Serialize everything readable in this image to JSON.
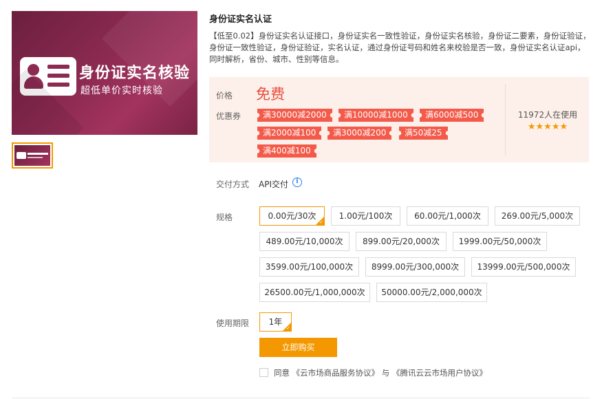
{
  "banner": {
    "title": "身份证实名核验",
    "subtitle": "超低单价实时核验"
  },
  "product": {
    "title": "身份证实名认证",
    "description": "【低至0.02】身份证实名认证接口，身份证实名一致性验证，身份证实名核验，身份证二要素，身份证验证，身份证一致性验证，身份证验证，实名认证，通过身份证号码和姓名来校验是否一致，身份证实名认证api，同时解析，省份、城市、性别等信息。"
  },
  "price": {
    "label": "价格",
    "value": "免费",
    "coupon_label": "优惠券",
    "coupons": [
      "满30000减2000",
      "满10000减1000",
      "满6000减500",
      "满2000减100",
      "满3000减200",
      "满50减25",
      "满400减100"
    ],
    "users": "11972人在使用",
    "stars": "★★★★★",
    "rating": 5
  },
  "delivery": {
    "label": "交付方式",
    "value": "API交付",
    "info_icon": "i"
  },
  "spec": {
    "label": "规格",
    "options": [
      "0.00元/30次",
      "1.00元/100次",
      "60.00元/1,000次",
      "269.00元/5,000次",
      "489.00元/10,000次",
      "899.00元/20,000次",
      "1999.00元/50,000次",
      "3599.00元/100,000次",
      "8999.00元/300,000次",
      "13999.00元/500,000次",
      "26500.00元/1,000,000次",
      "50000.00元/2,000,000次"
    ],
    "selected": "0.00元/30次"
  },
  "duration": {
    "label": "使用期限",
    "options": [
      "1年"
    ],
    "selected": "1年"
  },
  "actions": {
    "buy_label": "立即购买",
    "agree_text": "同意 《云市场商品服务协议》 与 《腾讯云云市场用户协议》"
  },
  "colors": {
    "accent": "#f39800",
    "price_red": "#e84d3d",
    "coupon_red": "#f35a4a",
    "price_box_bg": "#fdf0ea",
    "banner_purple": "#8c2a52"
  }
}
